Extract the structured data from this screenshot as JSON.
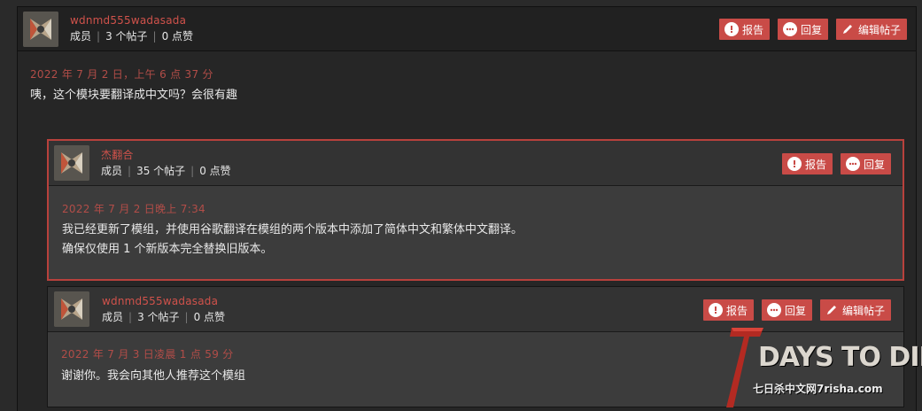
{
  "post": {
    "username": "wdnmd555wadasada",
    "role": "成员",
    "posts": "3 个帖子",
    "likes": "0 点赞",
    "date": "2022 年 7 月 2 日，上午 6 点 37 分",
    "text": "咦，这个模块要翻译成中文吗？会很有趣",
    "buttons": {
      "report": "报告",
      "reply": "回复",
      "edit": "编辑帖子"
    }
  },
  "reply1": {
    "username": "杰翻合",
    "role": "成员",
    "posts": "35 个帖子",
    "likes": "0 点赞",
    "date": "2022 年 7 月 2 日晚上 7:34",
    "text_line1": "我已经更新了模组，并使用谷歌翻译在模组的两个版本中添加了简体中文和繁体中文翻译。",
    "text_line2": "确保仅使用 1 个新版本完全替换旧版本。",
    "buttons": {
      "report": "报告",
      "reply": "回复"
    }
  },
  "reply2": {
    "username": "wdnmd555wadasada",
    "role": "成员",
    "posts": "3 个帖子",
    "likes": "0 点赞",
    "date": "2022 年 7 月 3 日凌晨 1 点 59 分",
    "text": "谢谢你。我会向其他人推荐这个模组",
    "buttons": {
      "report": "报告",
      "reply": "回复",
      "edit": "编辑帖子"
    }
  },
  "watermark": {
    "title": "DAYS TO DIE",
    "subtitle": "七日杀中文网7risha.com"
  },
  "colors": {
    "accent": "#c94b47",
    "username": "#d0524b",
    "date": "#b24d48",
    "highlight_border": "#b8413c"
  }
}
